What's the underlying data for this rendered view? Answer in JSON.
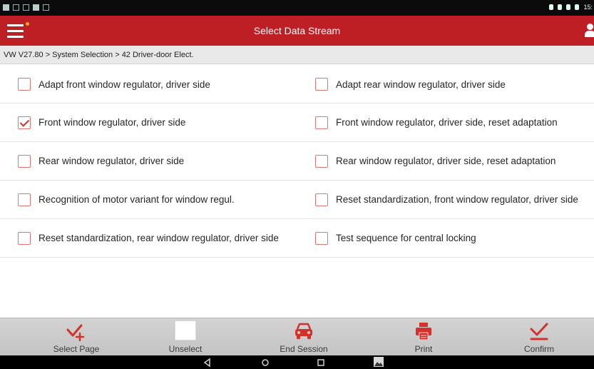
{
  "app": {
    "title": "Select Data Stream",
    "accent_color": "#be1f25",
    "status_time": "15:"
  },
  "breadcrumb": "VW V27.80 > System Selection > 42 Driver-door Elect.",
  "rows": [
    {
      "left": {
        "label": "Adapt front window regulator, driver side",
        "checked": false
      },
      "right": {
        "label": "Adapt rear window regulator, driver side",
        "checked": false
      }
    },
    {
      "left": {
        "label": "Front window regulator, driver side",
        "checked": true
      },
      "right": {
        "label": "Front window regulator, driver side, reset adaptation",
        "checked": false
      }
    },
    {
      "left": {
        "label": "Rear window regulator, driver side",
        "checked": false
      },
      "right": {
        "label": "Rear window regulator, driver side, reset adaptation",
        "checked": false
      }
    },
    {
      "left": {
        "label": "Recognition of motor variant for window regul.",
        "checked": false
      },
      "right": {
        "label": "Reset standardization, front window regulator, driver side",
        "checked": false
      }
    },
    {
      "left": {
        "label": "Reset standardization, rear window regulator, driver side",
        "checked": false
      },
      "right": {
        "label": "Test sequence for central locking",
        "checked": false
      }
    }
  ],
  "toolbar": {
    "select_page": "Select Page",
    "unselect": "Unselect",
    "end_session": "End Session",
    "print": "Print",
    "confirm": "Confirm"
  },
  "icons": {
    "menu": "hamburger-icon",
    "user": "user-icon",
    "select_page": "check-plus-icon",
    "unselect": "empty-square-icon",
    "end_session": "car-icon",
    "print": "printer-icon",
    "confirm": "check-underline-icon",
    "nav_back": "back-triangle-icon",
    "nav_home": "home-circle-icon",
    "nav_recents": "recents-square-icon",
    "nav_screenshot": "gallery-icon"
  }
}
